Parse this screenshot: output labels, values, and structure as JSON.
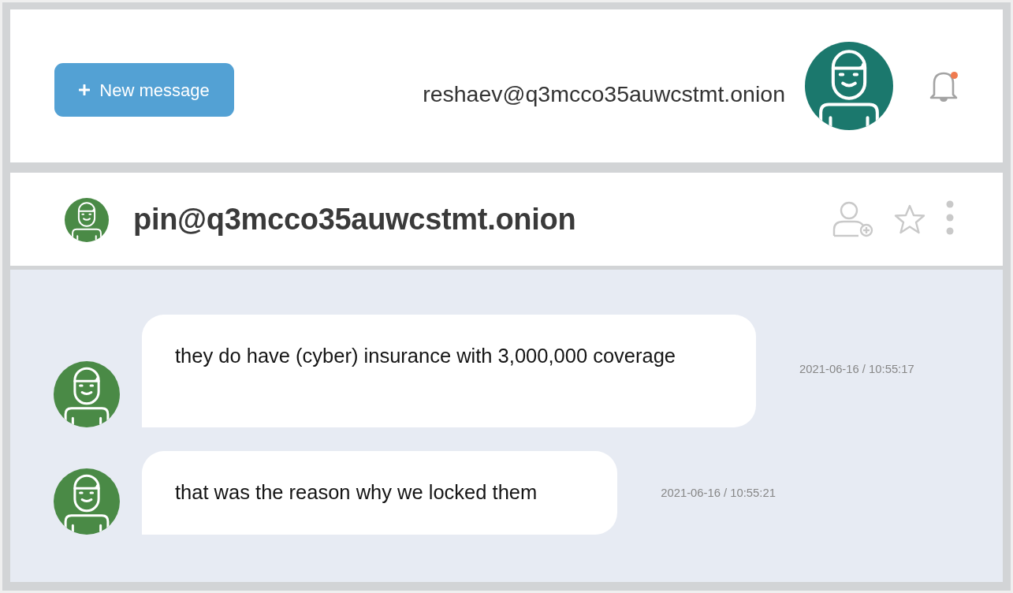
{
  "header": {
    "new_message_button": {
      "label": "New message"
    },
    "account": "reshaev@q3mcco35auwcstmt.onion",
    "notification_unread": true
  },
  "conversation": {
    "contact": "pin@q3mcco35auwcstmt.onion"
  },
  "messages": [
    {
      "text": "they do have (cyber) insurance with 3,000,000 coverage",
      "time": "2021-06-16 / 10:55:17"
    },
    {
      "text": "that was the reason why we locked them",
      "time": "2021-06-16 / 10:55:21"
    }
  ]
}
